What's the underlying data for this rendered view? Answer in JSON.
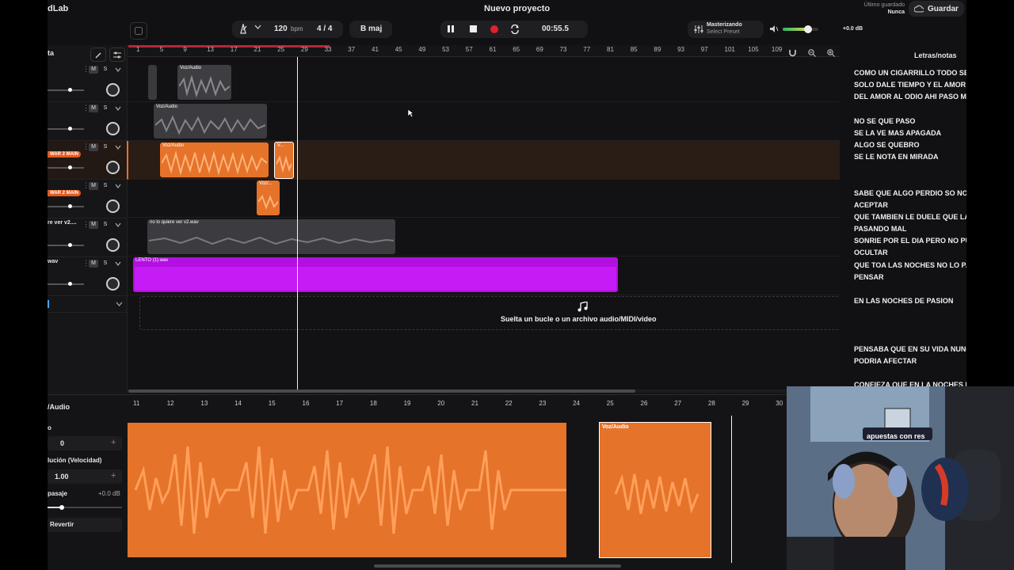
{
  "app": {
    "brand": "dLab",
    "project_title": "Nuevo proyecto",
    "last_saved_label": "Último guardado",
    "last_saved_value": "Nunca",
    "save_label": "Guardar"
  },
  "transport": {
    "bpm": "120",
    "bpm_unit": "bpm",
    "signature": "4 / 4",
    "key": "B maj",
    "time": "00:55.5"
  },
  "mastering": {
    "title": "Masterizando",
    "preset": "Select Preset"
  },
  "master_volume": {
    "db": "+0.0 dB",
    "level": 0.72
  },
  "tracks_header_title": "ta",
  "ruler_marks": [
    "1",
    "5",
    "9",
    "13",
    "17",
    "21",
    "25",
    "29",
    "33",
    "37",
    "41",
    "45",
    "49",
    "53",
    "57",
    "61",
    "65",
    "69",
    "73",
    "77",
    "81",
    "85",
    "89",
    "93",
    "97",
    "101",
    "105",
    "109"
  ],
  "tracks": [
    {
      "name": "",
      "badge": "",
      "mute": "M",
      "solo": "S"
    },
    {
      "name": "",
      "badge": "",
      "mute": "M",
      "solo": "S"
    },
    {
      "name": "",
      "badge": "WAR 2 MAIN",
      "mute": "M",
      "solo": "S"
    },
    {
      "name": "",
      "badge": "WAR 2 MAIN",
      "mute": "M",
      "solo": "S"
    },
    {
      "name": "re ver v2....",
      "badge": "",
      "mute": "M",
      "solo": "S"
    },
    {
      "name": "wav",
      "badge": "",
      "mute": "M",
      "solo": "S"
    }
  ],
  "clips": {
    "c1": "Voz/Audio",
    "c2": "Voz/Audio",
    "c3": "Voz/Audio",
    "c4": "V...",
    "c5": "Voz/...",
    "c6": "no lo quiere ver v2.wav",
    "c7": "LENTO (1).wav"
  },
  "drop_zone": "Suelta un bucle o un archivo audio/MIDI/video",
  "lyrics": {
    "title": "Letras/notas",
    "lines": [
      "COMO UN CIGARRILLO TODO SE",
      "SOLO DALE  TIEMPO Y EL AMOR",
      " DEL AMOR AL ODIO AHI PASO M",
      "NO SE QUE PASO",
      "SE LA VE MAS APAGADA",
      "ALGO SE QUEBRO",
      "SE LE NOTA EN MIRADA",
      "SABE QUE ALGO PERDIO SO NO",
      "ACEPTAR",
      "QUE TAMBIEN LE DUELE QUE LA",
      "PASANDO MAL",
      "SONRIE POR EL DIA PERO NO PU",
      "OCULTAR",
      "QUE TOA LAS NOCHES NO LO PA",
      "PENSAR",
      "EN LAS NOCHES DE PASION",
      "PENSABA QUE EN SU VIDA NUNC",
      "PODRIA AFECTAR",
      "CONFIEZA QUE EN LA NOCHES L"
    ]
  },
  "editor": {
    "clip_type": "/Audio",
    "field1_label": "o",
    "field1_value": "0",
    "speed_label": "lución (Velocidad)",
    "speed_value": "1.00",
    "pan_label": "pasaje",
    "pan_value": "+0.0 dB",
    "revert_label": "Revertir",
    "ruler": [
      "11",
      "12",
      "13",
      "14",
      "15",
      "16",
      "17",
      "18",
      "19",
      "20",
      "21",
      "22",
      "23",
      "24",
      "25",
      "26",
      "27",
      "28",
      "29",
      "30"
    ],
    "clip_label": "Voz/Audio"
  },
  "webcam": {
    "cap_text": "apuestas con res"
  },
  "colors": {
    "accent_orange": "#e5732a",
    "purple": "#b20fe0",
    "record": "#e0202a",
    "loop": "#b5263a"
  }
}
